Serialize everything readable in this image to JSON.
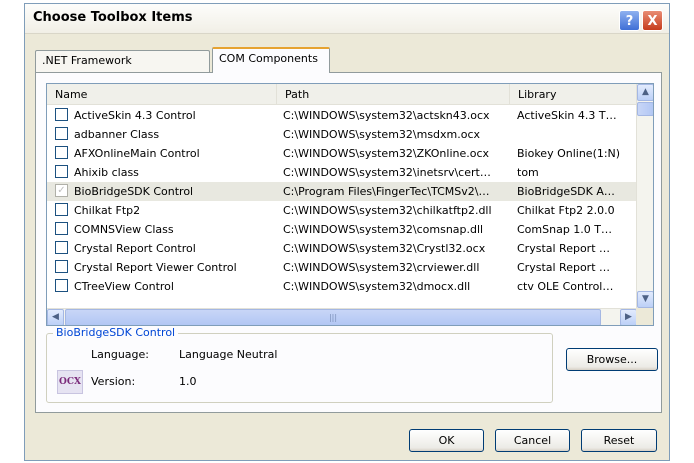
{
  "window": {
    "title": "Choose Toolbox Items"
  },
  "title_buttons": {
    "help": "?",
    "close": "X"
  },
  "tabs": [
    {
      "label": ".NET Framework Components"
    },
    {
      "label": "COM Components"
    }
  ],
  "list": {
    "columns": {
      "name": "Name",
      "path": "Path",
      "library": "Library"
    },
    "rows": [
      {
        "name": "ActiveSkin 4.3 Control",
        "path": "C:\\WINDOWS\\system32\\actskn43.ocx",
        "library": "ActiveSkin 4.3 T…",
        "checked": false
      },
      {
        "name": "adbanner Class",
        "path": "C:\\WINDOWS\\system32\\msdxm.ocx",
        "library": "",
        "checked": false
      },
      {
        "name": "AFXOnlineMain Control",
        "path": "C:\\WINDOWS\\system32\\ZKOnline.ocx",
        "library": "Biokey Online(1:N)",
        "checked": false
      },
      {
        "name": "Ahixib class",
        "path": "C:\\WINDOWS\\system32\\inetsrv\\cert…",
        "library": "tom",
        "checked": false
      },
      {
        "name": "BioBridgeSDK Control",
        "path": "C:\\Program Files\\FingerTec\\TCMSv2\\…",
        "library": "BioBridgeSDK A…",
        "checked": true
      },
      {
        "name": "Chilkat Ftp2",
        "path": "C:\\WINDOWS\\system32\\chilkatftp2.dll",
        "library": "Chilkat Ftp2 2.0.0",
        "checked": false
      },
      {
        "name": "COMNSView Class",
        "path": "C:\\WINDOWS\\system32\\comsnap.dll",
        "library": "ComSnap 1.0 T…",
        "checked": false
      },
      {
        "name": "Crystal Report Control",
        "path": "C:\\WINDOWS\\system32\\Crystl32.ocx",
        "library": "Crystal Report …",
        "checked": false
      },
      {
        "name": "Crystal Report Viewer Control",
        "path": "C:\\WINDOWS\\system32\\crviewer.dll",
        "library": "Crystal Report …",
        "checked": false
      },
      {
        "name": "CTreeView Control",
        "path": "C:\\WINDOWS\\system32\\dmocx.dll",
        "library": "ctv OLE Control…",
        "checked": false
      }
    ],
    "check_glyph": "✓"
  },
  "scroll": {
    "up": "▲",
    "down": "▼",
    "left": "◀",
    "right": "▶",
    "grip": "|||"
  },
  "details": {
    "group_title": "BioBridgeSDK Control",
    "icon_text": "OCX",
    "language_label": "Language:",
    "language_value": "Language Neutral",
    "version_label": "Version:",
    "version_value": "1.0"
  },
  "buttons": {
    "browse": "Browse...",
    "ok": "OK",
    "cancel": "Cancel",
    "reset": "Reset"
  },
  "colors": {
    "tab_highlight": "#e6a331",
    "group_title": "#0046d5",
    "close_button": "#c63c1c",
    "help_button": "#3f6fd6"
  }
}
